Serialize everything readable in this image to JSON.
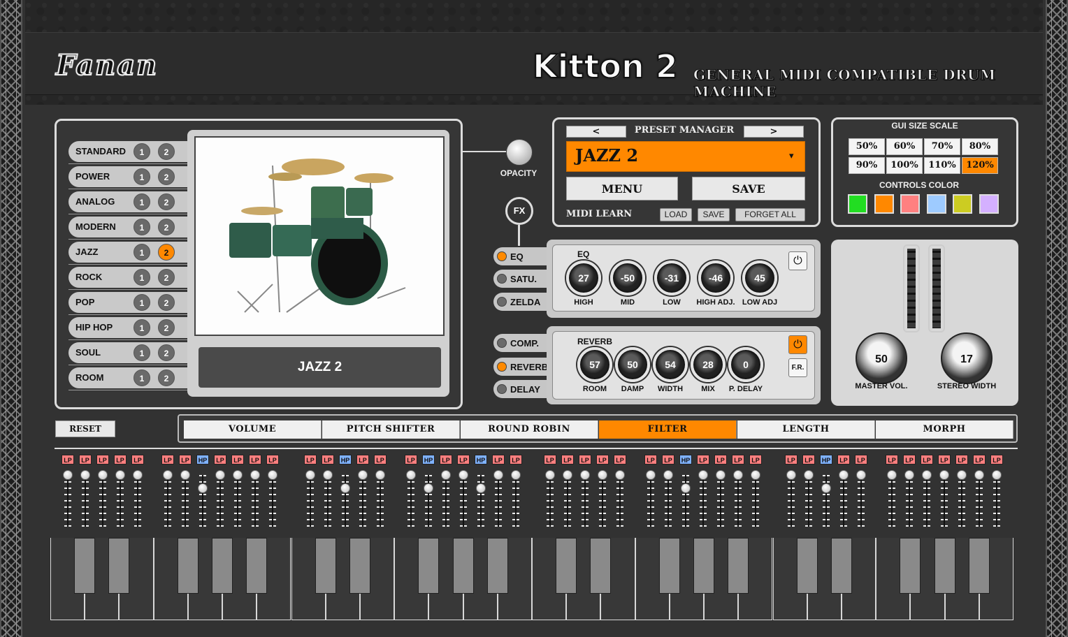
{
  "header": {
    "brand": "Fanan",
    "title": "Kitton 2",
    "subtitle": "GENERAL MIDI COMPATIBLE DRUM MACHINE"
  },
  "kits": [
    {
      "label": "STANDARD",
      "active": 0
    },
    {
      "label": "POWER",
      "active": 0
    },
    {
      "label": "ANALOG",
      "active": 0
    },
    {
      "label": "MODERN",
      "active": 0
    },
    {
      "label": "JAZZ",
      "active": 2
    },
    {
      "label": "ROCK",
      "active": 0
    },
    {
      "label": "POP",
      "active": 0
    },
    {
      "label": "HIP HOP",
      "active": 0
    },
    {
      "label": "SOUL",
      "active": 0
    },
    {
      "label": "ROOM",
      "active": 0
    }
  ],
  "variant_labels": [
    "1",
    "2"
  ],
  "kit_name": "JAZZ 2",
  "opacity_label": "OPACITY",
  "fx_label": "FX",
  "preset": {
    "title": "PRESET MANAGER",
    "prev": "<",
    "next": ">",
    "name": "JAZZ 2",
    "dropdown": "▾",
    "menu": "MENU",
    "save": "SAVE",
    "midi_learn": "MIDI LEARN",
    "load": "LOAD",
    "save_small": "SAVE",
    "forget_all": "FORGET ALL"
  },
  "gui": {
    "title": "GUI SIZE SCALE",
    "scales": [
      "50%",
      "60%",
      "70%",
      "80%",
      "90%",
      "100%",
      "110%",
      "120%"
    ],
    "selected_scale": "120%",
    "colors_title": "CONTROLS COLOR",
    "colors": [
      "#22dd22",
      "#ff8800",
      "#ff8080",
      "#9ecbff",
      "#cccc22",
      "#d4b0ff"
    ]
  },
  "fx_buttons": {
    "eq": "EQ",
    "satu": "SATU.",
    "zelda": "ZELDA",
    "comp": "COMP.",
    "reverb": "REVERB",
    "delay": "DELAY"
  },
  "eq": {
    "title": "EQ",
    "knobs": [
      {
        "label": "HIGH",
        "value": "27"
      },
      {
        "label": "MID",
        "value": "-50"
      },
      {
        "label": "LOW",
        "value": "-31"
      },
      {
        "label": "HIGH ADJ.",
        "value": "-46"
      },
      {
        "label": "LOW ADJ",
        "value": "45"
      }
    ]
  },
  "reverb": {
    "title": "REVERB",
    "fr": "F.R.",
    "knobs": [
      {
        "label": "ROOM",
        "value": "57"
      },
      {
        "label": "DAMP",
        "value": "50"
      },
      {
        "label": "WIDTH",
        "value": "54"
      },
      {
        "label": "MIX",
        "value": "28"
      },
      {
        "label": "P. DELAY",
        "value": "0"
      }
    ]
  },
  "master": {
    "vol_label": "MASTER VOL.",
    "vol_value": "50",
    "width_label": "STEREO WIDTH",
    "width_value": "17"
  },
  "reset": "RESET",
  "tabs": [
    "VOLUME",
    "PITCH SHIFTER",
    "ROUND ROBIN",
    "FILTER",
    "LENGTH",
    "MORPH"
  ],
  "selected_tab": "FILTER",
  "filter_groups": [
    [
      "LP",
      "LP",
      "LP",
      "LP",
      "LP"
    ],
    [
      "LP",
      "LP",
      "HP",
      "LP",
      "LP",
      "LP",
      "LP"
    ],
    [
      "LP",
      "LP",
      "HP",
      "LP",
      "LP"
    ],
    [
      "LP",
      "HP",
      "LP",
      "LP",
      "HP",
      "LP",
      "LP"
    ],
    [
      "LP",
      "LP",
      "LP",
      "LP",
      "LP"
    ],
    [
      "LP",
      "LP",
      "HP",
      "LP",
      "LP",
      "LP",
      "LP"
    ],
    [
      "LP",
      "LP",
      "HP",
      "LP",
      "LP"
    ],
    [
      "LP",
      "LP",
      "LP",
      "LP",
      "LP",
      "LP",
      "LP"
    ]
  ]
}
